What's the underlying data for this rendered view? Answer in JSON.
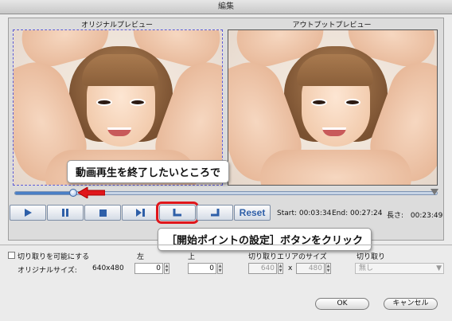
{
  "window": {
    "title": "編集"
  },
  "preview": {
    "original_label": "オリジナルプレビュー",
    "output_label": "アウトプットプレビュー"
  },
  "callouts": {
    "stop_here": "動画再生を終了したいところで",
    "set_start": "［開始ポイントの設定］ボタンをクリック"
  },
  "timeline": {
    "position_fraction": 0.14
  },
  "controls": {
    "play_icon": "play-icon",
    "pause_icon": "pause-icon",
    "stop_icon": "stop-icon",
    "step_icon": "step-forward-icon",
    "set_start_icon": "set-start-point-icon",
    "set_end_icon": "set-end-point-icon",
    "reset_label": "Reset",
    "accent_color": "#2e5fa8",
    "highlight_color": "#e0161b"
  },
  "times": {
    "start_label": "Start:",
    "start_value": "00:03:34",
    "end_label": "End:",
    "end_value": "00:27:24",
    "length_label": "長さ:",
    "length_value": "00:23:49"
  },
  "crop": {
    "enable_label": "切り取りを可能にする",
    "left_label": "左",
    "top_label": "上",
    "area_size_label": "切り取りエリアのサイズ",
    "crop_label": "切り取り",
    "original_size_label": "オリジナルサイズ:",
    "original_size_value": "640x480",
    "left_value": "0",
    "top_value": "0",
    "width_value": "640",
    "x_label": "x",
    "height_value": "480",
    "crop_select_value": "無し"
  },
  "footer": {
    "ok_label": "OK",
    "cancel_label": "キャンセル"
  }
}
